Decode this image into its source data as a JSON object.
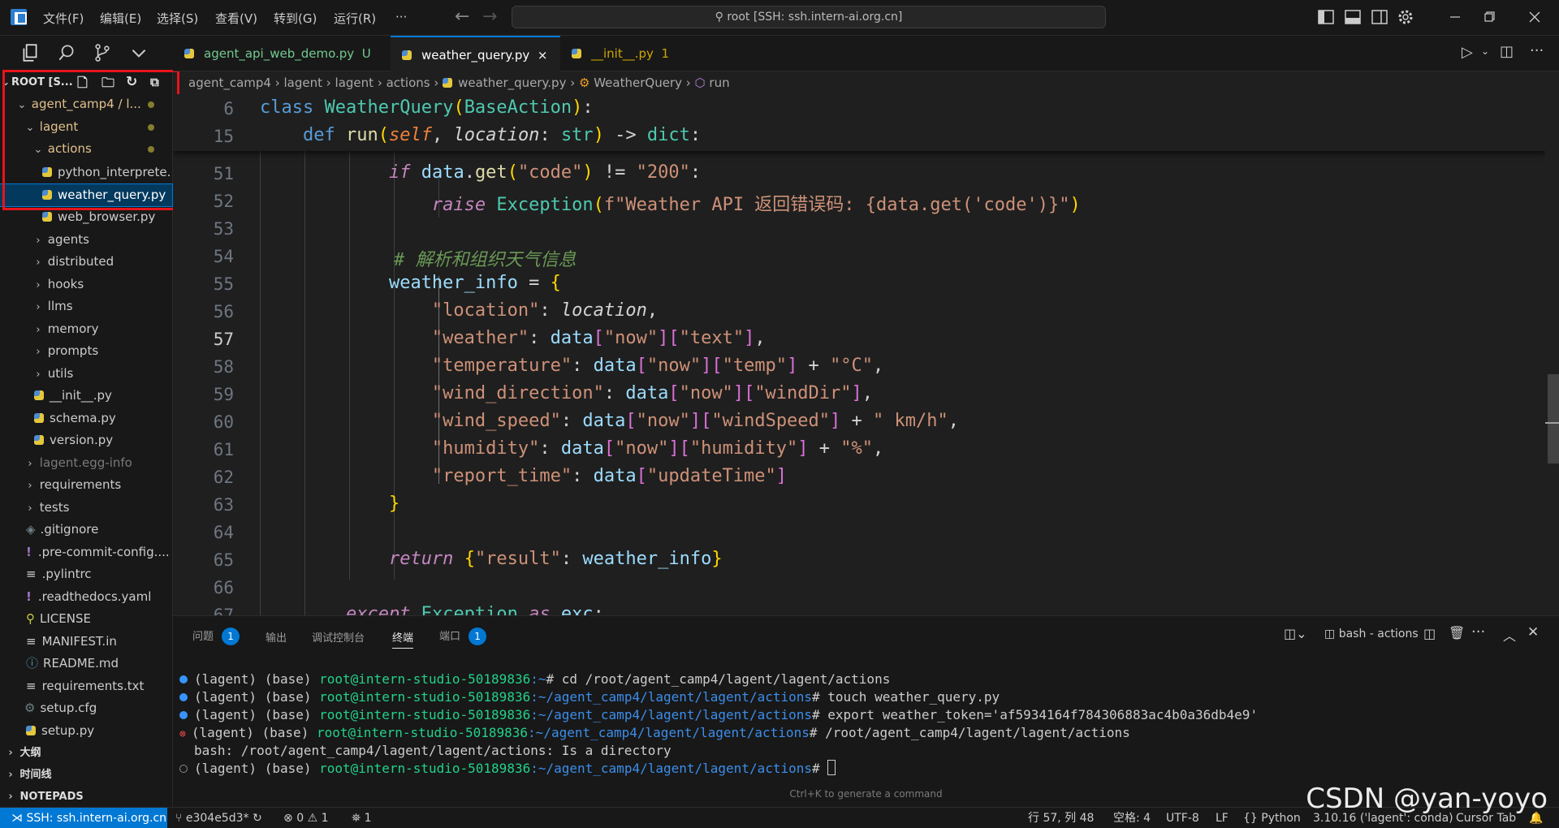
{
  "titlebar": {
    "menus": [
      "文件(F)",
      "编辑(E)",
      "选择(S)",
      "查看(V)",
      "转到(G)",
      "运行(R)",
      "···"
    ],
    "search": "root [SSH: ssh.intern-ai.org.cn]"
  },
  "explorer": {
    "root_label": "ROOT [S...",
    "items": [
      {
        "label": "agent_camp4 / l...",
        "type": "folder-open",
        "modified": true
      },
      {
        "label": "lagent",
        "type": "folder-open",
        "modified": true
      },
      {
        "label": "actions",
        "type": "folder-open",
        "modified": true
      },
      {
        "label": "python_interprete...",
        "type": "py"
      },
      {
        "label": "weather_query.py",
        "type": "py",
        "selected": true
      },
      {
        "label": "web_browser.py",
        "type": "py"
      },
      {
        "label": "agents",
        "type": "folder"
      },
      {
        "label": "distributed",
        "type": "folder"
      },
      {
        "label": "hooks",
        "type": "folder"
      },
      {
        "label": "llms",
        "type": "folder"
      },
      {
        "label": "memory",
        "type": "folder"
      },
      {
        "label": "prompts",
        "type": "folder"
      },
      {
        "label": "utils",
        "type": "folder"
      },
      {
        "label": "__init__.py",
        "type": "py"
      },
      {
        "label": "schema.py",
        "type": "py"
      },
      {
        "label": "version.py",
        "type": "py"
      },
      {
        "label": "lagent.egg-info",
        "type": "folder"
      },
      {
        "label": "requirements",
        "type": "folder"
      },
      {
        "label": "tests",
        "type": "folder"
      },
      {
        "label": ".gitignore",
        "type": "file"
      },
      {
        "label": ".pre-commit-config....",
        "type": "yaml"
      },
      {
        "label": ".pylintrc",
        "type": "file"
      },
      {
        "label": ".readthedocs.yaml",
        "type": "yaml"
      },
      {
        "label": "LICENSE",
        "type": "file"
      },
      {
        "label": "MANIFEST.in",
        "type": "file"
      },
      {
        "label": "README.md",
        "type": "md"
      },
      {
        "label": "requirements.txt",
        "type": "file"
      },
      {
        "label": "setup.cfg",
        "type": "cfg"
      },
      {
        "label": "setup.py",
        "type": "py"
      }
    ],
    "sections": [
      "大纲",
      "时间线",
      "NOTEPADS"
    ]
  },
  "tabs": [
    {
      "label": "agent_api_web_demo.py",
      "suffix": "U"
    },
    {
      "label": "weather_query.py",
      "suffix": "×",
      "active": true
    },
    {
      "label": "__init__.py",
      "suffix": "1"
    }
  ],
  "breadcrumb": [
    "agent_camp4",
    "lagent",
    "lagent",
    "actions",
    "weather_query.py",
    "WeatherQuery",
    "run"
  ],
  "code": {
    "sticky": [
      {
        "ln": "6"
      },
      {
        "ln": "15"
      }
    ],
    "lines": [
      {
        "ln": "51"
      },
      {
        "ln": "52"
      },
      {
        "ln": "53"
      },
      {
        "ln": "54"
      },
      {
        "ln": "55"
      },
      {
        "ln": "56"
      },
      {
        "ln": "57",
        "current": true
      },
      {
        "ln": "58"
      },
      {
        "ln": "59"
      },
      {
        "ln": "60"
      },
      {
        "ln": "61"
      },
      {
        "ln": "62"
      },
      {
        "ln": "63"
      },
      {
        "ln": "64"
      },
      {
        "ln": "65"
      },
      {
        "ln": "66"
      },
      {
        "ln": "67"
      }
    ],
    "comment": "# 解析和组织天气信息",
    "exception_msg": "f\"Weather API 返回错误码: {data.get('code')}\""
  },
  "panel": {
    "tabs": [
      {
        "label": "问题",
        "badge": "1"
      },
      {
        "label": "输出"
      },
      {
        "label": "调试控制台"
      },
      {
        "label": "终端",
        "active": true
      },
      {
        "label": "端口",
        "badge": "1"
      }
    ],
    "terminal_name": "bash - actions",
    "prefix": "(lagent) (base) ",
    "user": "root@intern-studio-50189836",
    "lines": [
      {
        "path": ":~",
        "cmd": "# cd /root/agent_camp4/lagent/lagent/actions"
      },
      {
        "path": ":~/agent_camp4/lagent/lagent/actions",
        "cmd": "# touch weather_query.py"
      },
      {
        "path": ":~/agent_camp4/lagent/lagent/actions",
        "cmd": "# export weather_token='af5934164f784306883ac4b0a36db4e9'"
      },
      {
        "path": ":~/agent_camp4/lagent/lagent/actions",
        "cmd": "# /root/agent_camp4/lagent/lagent/actions"
      },
      {
        "output": "bash: /root/agent_camp4/lagent/lagent/actions: Is a directory"
      },
      {
        "path": ":~/agent_camp4/lagent/lagent/actions",
        "cmd": "# "
      }
    ],
    "hint": "Ctrl+K to generate a command"
  },
  "status": {
    "remote": "SSH: ssh.intern-ai.org.cn",
    "branch": "e304e5d3*",
    "errors": "0",
    "warnings": "1",
    "ports": "1",
    "position": "行 57, 列 48",
    "indent": "空格: 4",
    "encoding": "UTF-8",
    "eol": "LF",
    "language": "Python",
    "interpreter": "3.10.16 ('lagent': conda)",
    "cursor_tab": "Cursor Tab"
  },
  "watermark": "CSDN @yan-yoyo"
}
